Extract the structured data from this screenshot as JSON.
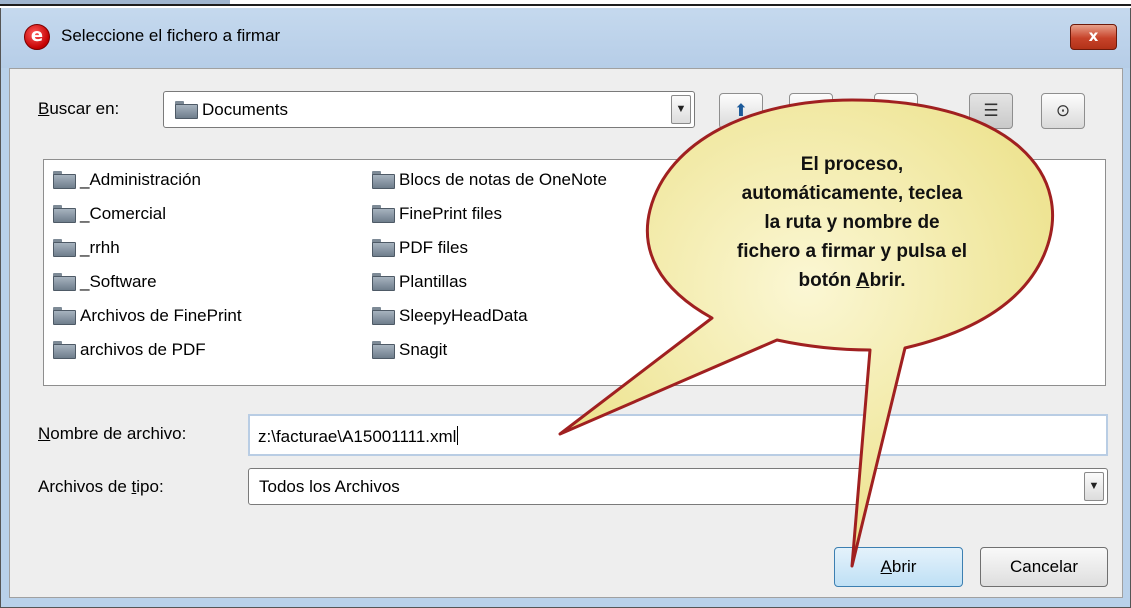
{
  "dialog": {
    "title": "Seleccione el fichero a firmar",
    "close_label": "x",
    "app_icon_glyph": "e"
  },
  "lookin": {
    "label_first": "B",
    "label_rest": "uscar en:",
    "value": "Documents"
  },
  "toolbar": {
    "icons": [
      "up-folder-icon",
      "home-icon",
      "new-folder-icon",
      "list-view-icon",
      "details-view-icon"
    ]
  },
  "files": {
    "col1": [
      "_Administración",
      "_Comercial",
      "_rrhh",
      "_Software",
      "Archivos de FinePrint",
      "archivos de PDF"
    ],
    "col2": [
      "Blocs de notas de OneNote",
      "FinePrint files",
      "PDF files",
      "Plantillas",
      "SleepyHeadData",
      "Snagit"
    ]
  },
  "filename": {
    "label_first": "N",
    "label_rest": "ombre de archivo:",
    "value": "z:\\facturae\\A15001111.xml"
  },
  "filetype": {
    "label_before": "Archivos de ",
    "label_underlined": "t",
    "label_after": "ipo:",
    "value": "Todos los Archivos"
  },
  "buttons": {
    "open_first": "A",
    "open_rest": "brir",
    "cancel": "Cancelar"
  },
  "callout": {
    "line1": "El proceso,",
    "line2": "automáticamente, teclea",
    "line3": "la ruta y nombre de",
    "line4": "fichero a firmar y pulsa el",
    "line5_before": "botón ",
    "line5_underlined": "A",
    "line5_after": "brir."
  },
  "colors": {
    "title_bg": "#b9d1ea",
    "dialog_bg": "#eeeeee",
    "callout_fill": "#f6f0b5",
    "callout_border": "#a02020",
    "open_button": "#bfe0f5"
  }
}
